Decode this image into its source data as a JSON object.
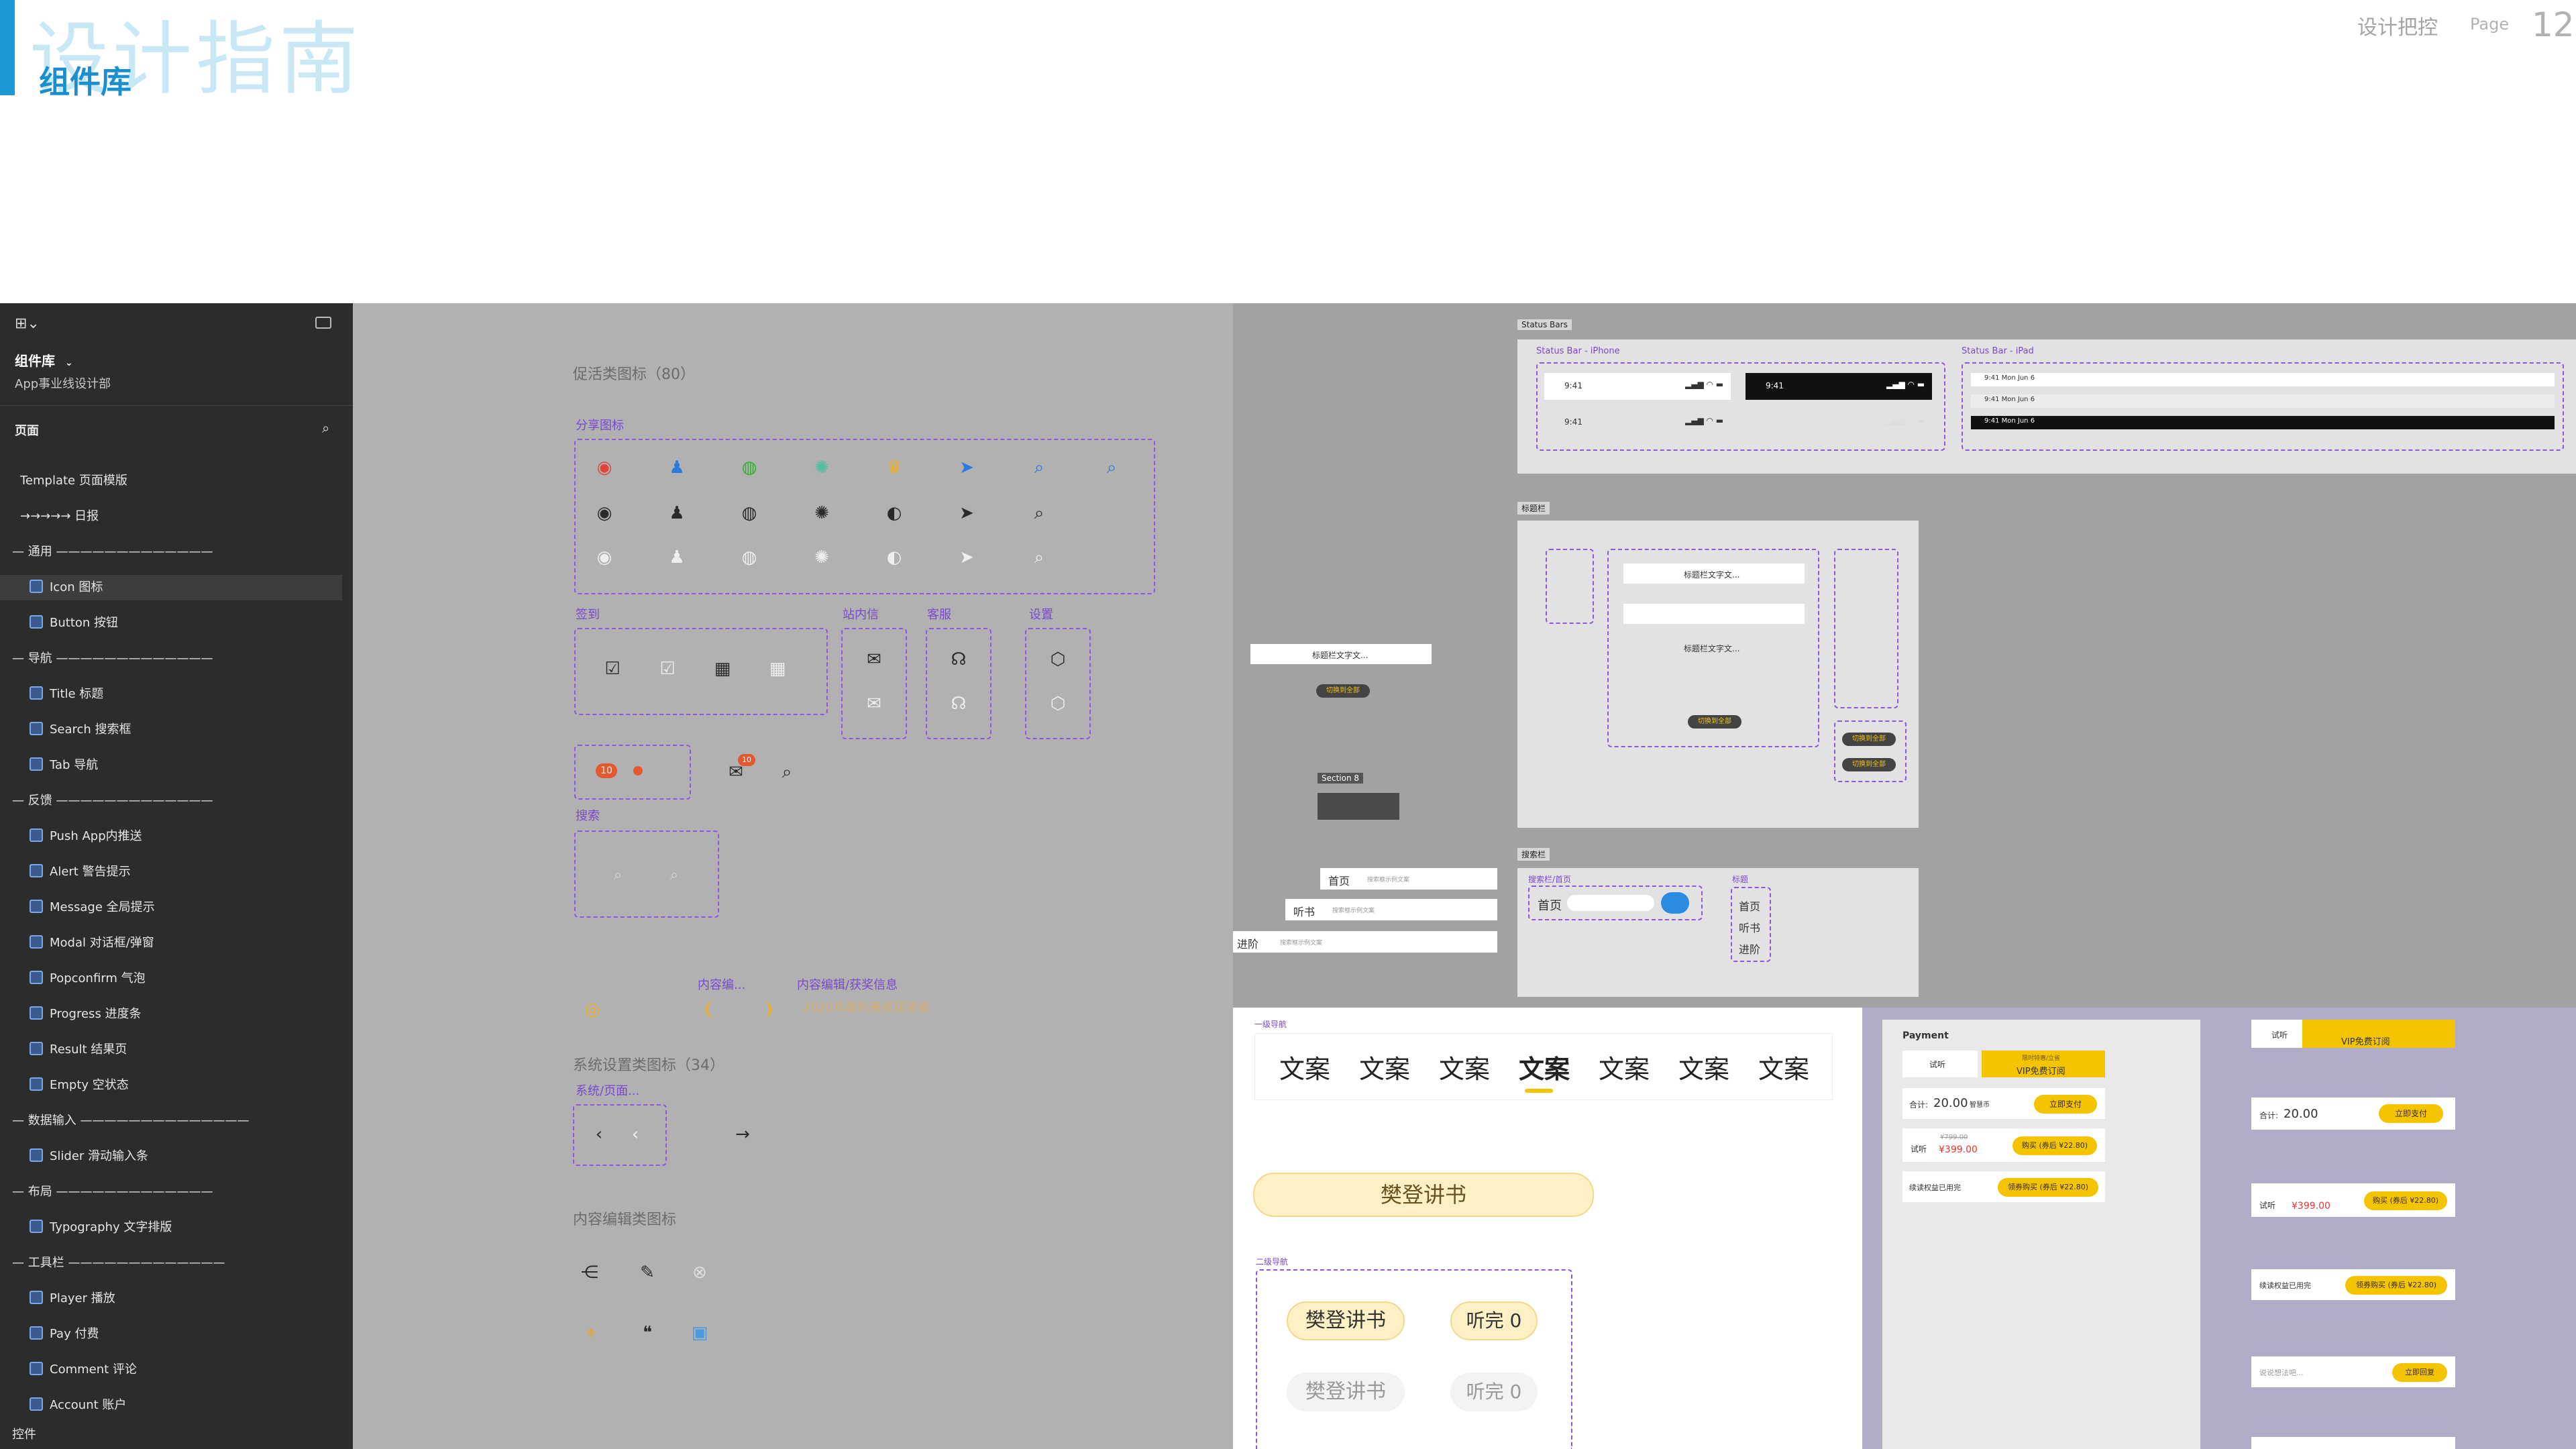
{
  "slide": {
    "ghost_title": "设计指南",
    "title": "组件库",
    "section": "设计把控",
    "page_label": "Page",
    "page_number": "12"
  },
  "sidebar": {
    "file_title": "组件库",
    "file_subtitle": "App事业线设计部",
    "pages_header": "页面",
    "items": [
      {
        "label": "Template 页面模版",
        "icon": false
      },
      {
        "label": "→→→→→  日报",
        "icon": false
      },
      {
        "label": "— 通用 —————————————",
        "icon": false
      },
      {
        "label": "Icon 图标",
        "icon": true
      },
      {
        "label": "Button 按钮",
        "icon": true
      },
      {
        "label": "— 导航 —————————————",
        "icon": false
      },
      {
        "label": "Title 标题",
        "icon": true
      },
      {
        "label": "Search 搜索框",
        "icon": true
      },
      {
        "label": "Tab 导航",
        "icon": true
      },
      {
        "label": "— 反馈 —————————————",
        "icon": false
      },
      {
        "label": "Push App内推送",
        "icon": true
      },
      {
        "label": "Alert 警告提示",
        "icon": true
      },
      {
        "label": "Message 全局提示",
        "icon": true
      },
      {
        "label": "Modal 对话框/弹窗",
        "icon": true
      },
      {
        "label": "Popconfirm 气泡",
        "icon": true
      },
      {
        "label": "Progress 进度条",
        "icon": true
      },
      {
        "label": "Result 结果页",
        "icon": true
      },
      {
        "label": "Empty 空状态",
        "icon": true
      },
      {
        "label": "— 数据输入 ——————————————",
        "icon": false
      },
      {
        "label": "Slider 滑动输入条",
        "icon": true
      },
      {
        "label": "— 布局 —————————————",
        "icon": false
      },
      {
        "label": "Typography 文字排版",
        "icon": true
      },
      {
        "label": "— 工具栏 —————————————",
        "icon": false
      },
      {
        "label": "Player 播放",
        "icon": true
      },
      {
        "label": "Pay 付费",
        "icon": true
      },
      {
        "label": "Comment 评论",
        "icon": true
      },
      {
        "label": "Account 账户",
        "icon": true
      },
      {
        "label": "控件",
        "icon": false
      }
    ]
  },
  "canvas": {
    "promo_title": "促活类图标（80）",
    "share_label": "分享图标",
    "checkin_label": "签到",
    "inbox_label": "站内信",
    "service_label": "客服",
    "settings_label": "设置",
    "search_label": "搜索",
    "badge_num": "10",
    "content_label": "内容编...",
    "content_label2": "内容编辑/获奖信息",
    "award_text": "2020年最利美奖获奖者",
    "system_title": "系统设置类图标（34）",
    "system_label": "系统/页面...",
    "edit_title": "内容编辑类图标",
    "status_bars_tag": "Status Bars",
    "status_iphone": "Status Bar - iPhone",
    "status_ipad": "Status Bar - iPad",
    "time": "9:41",
    "ipad_time": "9:41  Mon Jun 6",
    "title_tag": "标题栏",
    "title_text": "标题栏文字文...",
    "switch_text": "切换到全部",
    "section_tag": "Section 8",
    "search_tag": "搜索栏",
    "search_home": "搜索栏/首页",
    "search_title_lbl": "标题",
    "home": "首页",
    "listen": "听书",
    "advance": "进阶",
    "search_ph": "搜索框示例文案",
    "tab_l1": "一级导航",
    "tab_l2": "二级导航",
    "tabs": [
      "文案",
      "文案",
      "文案",
      "文案",
      "文案",
      "文案",
      "文案"
    ],
    "fandeng": "樊登讲书",
    "finish": "听完 0",
    "payment_tag": "Payment",
    "trial": "试听",
    "vip": "VIP免费订阅",
    "vip_sub": "限时特惠/立省",
    "total_label": "合计:",
    "total_price": "20.00",
    "unit": "智慧币",
    "pay_now": "立即支付",
    "orig_price": "¥799.00",
    "sale_price": "¥399.00",
    "buy": "购买 (券后 ¥22.80)",
    "renew": "续读权益已用完",
    "renew_buy": "领券购买 (券后 ¥22.80)",
    "comment_ph": "说说想法吧...",
    "send": "立即回复",
    "colors": {
      "accent": "#1a9ad6",
      "purple": "#8d55e0",
      "yellow": "#f4c400",
      "cream": "#fdf0c4",
      "lavender": "#b3acc9"
    }
  }
}
